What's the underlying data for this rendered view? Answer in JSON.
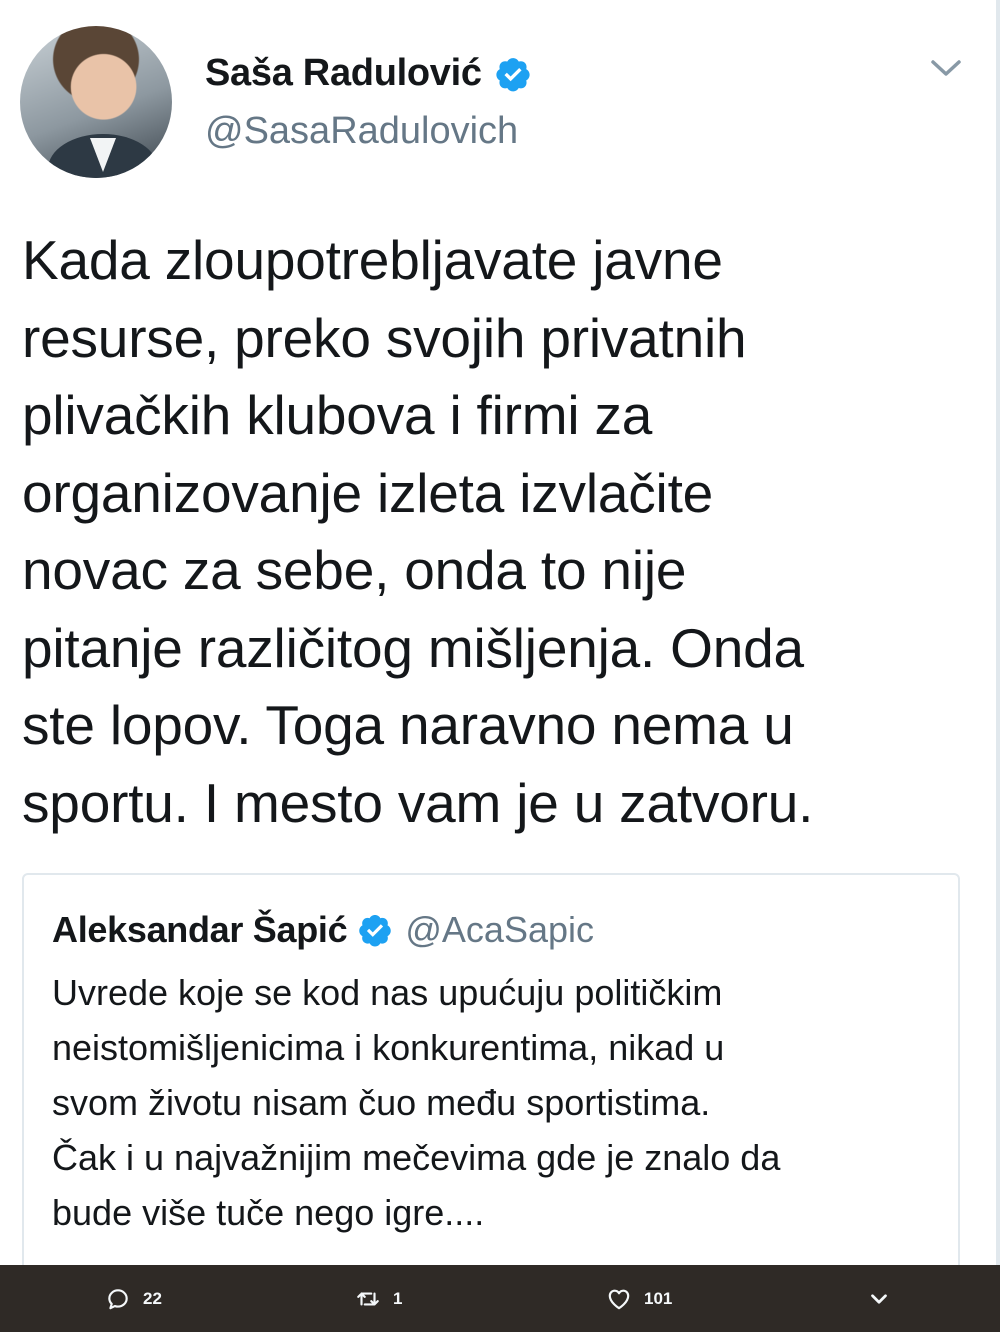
{
  "author": {
    "display_name": "Saša Radulović",
    "handle": "@SasaRadulovich",
    "verified": true
  },
  "tweet": {
    "lines": [
      "Kada zloupotrebljavate javne",
      "resurse, preko svojih privatnih",
      "plivačkih klubova i firmi za",
      "organizovanje izleta izvlačite",
      "novac za sebe, onda to nije",
      "pitanje različitog mišljenja. Onda",
      "ste lopov. Toga naravno nema u",
      "sportu. I mesto vam je u zatvoru."
    ]
  },
  "quoted_tweet": {
    "display_name": "Aleksandar Šapić",
    "handle": "@AcaSapic",
    "verified": true,
    "lines": [
      "Uvrede koje se kod nas upućuju političkim",
      "neistomišljenicima i konkurentima, nikad u",
      "svom životu nisam čuo među sportistima.",
      "Čak i u najvažnijim mečevima gde je znalo da",
      "bude više tuče nego igre...."
    ]
  },
  "actions": {
    "reply_count": "22",
    "retweet_count": "1",
    "like_count": "101"
  },
  "icons": {
    "reply": "reply-icon",
    "retweet": "retweet-icon",
    "like": "heart-icon",
    "more": "chevron-down-icon",
    "verified": "verified-badge-icon"
  },
  "colors": {
    "verified_blue": "#1da1f2",
    "secondary_text": "#657786",
    "action_bar_bg": "#2f2a26"
  }
}
